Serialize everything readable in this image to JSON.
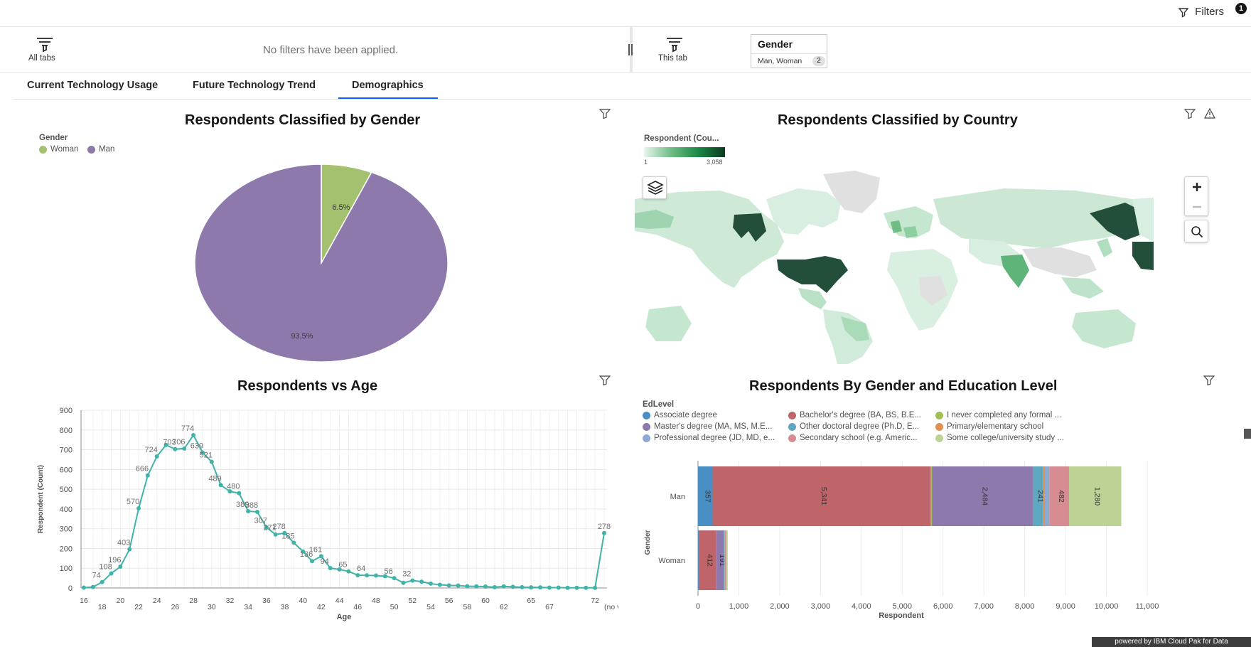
{
  "topbar": {
    "filters_label": "Filters",
    "filters_count": "1"
  },
  "filter_row": {
    "all_tabs_label": "All tabs",
    "no_filters_text": "No filters have been applied.",
    "this_tab_label": "This tab",
    "gender_card": {
      "title": "Gender",
      "value": "Man, Woman",
      "count": "2"
    }
  },
  "tabs": [
    {
      "label": "Current Technology Usage",
      "active": false
    },
    {
      "label": "Future Technology Trend",
      "active": false
    },
    {
      "label": "Demographics",
      "active": true
    }
  ],
  "gender_panel": {
    "title": "Respondents Classified by Gender",
    "legend_title": "Gender",
    "legend": [
      {
        "label": "Woman",
        "color": "#a3c16f"
      },
      {
        "label": "Man",
        "color": "#8d79ab"
      }
    ]
  },
  "country_panel": {
    "title": "Respondents Classified by Country",
    "legend_title": "Respondent (Cou...",
    "scale_min": "1",
    "scale_max": "3,058",
    "colors": [
      "#e8f5ec",
      "#1a3d2c"
    ]
  },
  "age_panel": {
    "title": "Respondents vs Age"
  },
  "edu_panel": {
    "title": "Respondents By Gender and Education Level",
    "legend_title": "EdLevel",
    "legend": [
      {
        "label": "Associate degree",
        "color": "#4a8fc4"
      },
      {
        "label": "Bachelor's degree (BA, BS, B.E...",
        "color": "#bf6468"
      },
      {
        "label": "I never completed any formal ...",
        "color": "#a3bd55"
      },
      {
        "label": "Master's degree (MA, MS, M.E...",
        "color": "#8d79ab"
      },
      {
        "label": "Other doctoral degree (Ph.D, E...",
        "color": "#5fa8c1"
      },
      {
        "label": "Primary/elementary school",
        "color": "#e0904f"
      },
      {
        "label": "Professional degree (JD, MD, e...",
        "color": "#8ca9d2"
      },
      {
        "label": "Secondary school (e.g. Americ...",
        "color": "#d68c92"
      },
      {
        "label": "Some college/university study ...",
        "color": "#bcd395"
      }
    ]
  },
  "footer": {
    "text": "powered by IBM Cloud Pak for Data"
  },
  "chart_data": [
    {
      "type": "pie",
      "title": "Respondents Classified by Gender",
      "legend_title": "Gender",
      "labels": [
        "Woman",
        "Man"
      ],
      "values": [
        6.5,
        93.5
      ],
      "value_labels": [
        "6.5%",
        "93.5%"
      ],
      "colors": [
        "#a3c16f",
        "#8d79ab"
      ],
      "legend": "top-left"
    },
    {
      "type": "line",
      "title": "Respondents vs Age",
      "xlabel": "Age",
      "ylabel": "Respondent (Count)",
      "ylim": [
        0,
        900
      ],
      "yticks": [
        0,
        100,
        200,
        300,
        400,
        500,
        600,
        700,
        800,
        900
      ],
      "xtick_labels": [
        "16",
        "18",
        "20",
        "22",
        "24",
        "26",
        "28",
        "30",
        "32",
        "34",
        "36",
        "38",
        "40",
        "42",
        "44",
        "46",
        "48",
        "50",
        "52",
        "54",
        "56",
        "58",
        "60",
        "62",
        "65",
        "67",
        "72",
        "(no val..."
      ],
      "x": [
        "16",
        "17",
        "18",
        "19",
        "20",
        "21",
        "22",
        "23",
        "24",
        "25",
        "26",
        "27",
        "28",
        "29",
        "30",
        "31",
        "32",
        "33",
        "34",
        "35",
        "36",
        "37",
        "38",
        "39",
        "40",
        "41",
        "42",
        "43",
        "44",
        "45",
        "46",
        "47",
        "48",
        "49",
        "50",
        "51",
        "52",
        "53",
        "54",
        "55",
        "56",
        "57",
        "58",
        "59",
        "60",
        "61",
        "62",
        "63",
        "64",
        "65",
        "66",
        "67",
        "68",
        "69",
        "70",
        "71",
        "72",
        "(no val..."
      ],
      "values": [
        2,
        5,
        30,
        74,
        108,
        196,
        403,
        570,
        666,
        724,
        703,
        706,
        774,
        686,
        639,
        521,
        489,
        480,
        389,
        385,
        307,
        271,
        278,
        229,
        185,
        136,
        161,
        101,
        94,
        84,
        65,
        64,
        63,
        60,
        50,
        26,
        38,
        32,
        22,
        16,
        13,
        12,
        9,
        8,
        7,
        4,
        8,
        6,
        4,
        3,
        3,
        2,
        2,
        1,
        1,
        1,
        1,
        278
      ],
      "data_labels": {
        "18": "74",
        "19": "108",
        "20": "196",
        "21": "403",
        "22": "570",
        "23": "666",
        "24": "724",
        "26": "703",
        "27": "706",
        "28": "774",
        "29": "639",
        "30": "521",
        "31": "489",
        "33": "480",
        "34": "389",
        "35": "388",
        "36": "307",
        "37": "271",
        "38": "278",
        "39": "185",
        "41": "136",
        "42": "161",
        "43": "94",
        "45": "65",
        "47": "64",
        "50": "56",
        "52": "32",
        "(no val...": "278"
      },
      "color": "#3fb3a8",
      "grid": true
    },
    {
      "type": "bar",
      "orientation": "horizontal",
      "stacked": true,
      "title": "Respondents By Gender and Education Level",
      "ylabel": "Gender",
      "xlabel": "Respondent",
      "categories": [
        "Man",
        "Woman"
      ],
      "xlim": [
        0,
        11000
      ],
      "xticks": [
        "0",
        "1,000",
        "2,000",
        "3,000",
        "4,000",
        "5,000",
        "6,000",
        "7,000",
        "8,000",
        "9,000",
        "10,000",
        "11,000"
      ],
      "series": [
        {
          "name": "Associate degree",
          "values": [
            357,
            25
          ],
          "labels": [
            "357",
            ""
          ]
        },
        {
          "name": "Bachelor's degree (BA, BS, B.E...",
          "values": [
            5341,
            412
          ],
          "labels": [
            "5,341",
            "412"
          ]
        },
        {
          "name": "I never completed any formal ...",
          "values": [
            30,
            4
          ],
          "labels": [
            "",
            ""
          ]
        },
        {
          "name": "Master's degree (MA, MS, M.E...",
          "values": [
            2484,
            191
          ],
          "labels": [
            "2,484",
            "191"
          ]
        },
        {
          "name": "Other doctoral degree (Ph.D, E...",
          "values": [
            241,
            15
          ],
          "labels": [
            "241",
            ""
          ]
        },
        {
          "name": "Primary/elementary school",
          "values": [
            40,
            3
          ],
          "labels": [
            "",
            ""
          ]
        },
        {
          "name": "Professional degree (JD, MD, e...",
          "values": [
            110,
            8
          ],
          "labels": [
            "",
            ""
          ]
        },
        {
          "name": "Secondary school (e.g. Americ...",
          "values": [
            482,
            30
          ],
          "labels": [
            "482",
            ""
          ]
        },
        {
          "name": "Some college/university study ...",
          "values": [
            1280,
            40
          ],
          "labels": [
            "1,280",
            ""
          ]
        }
      ],
      "legend": "top-left"
    }
  ]
}
